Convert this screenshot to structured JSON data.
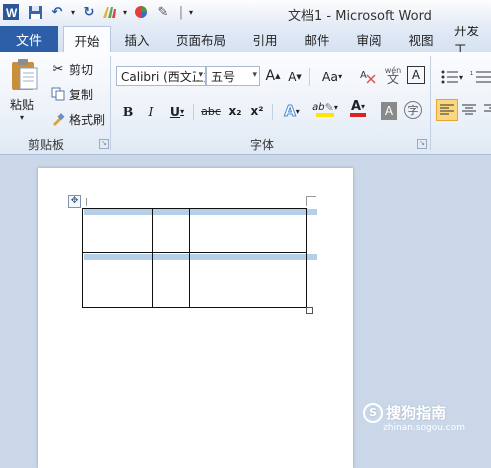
{
  "window": {
    "title": "文档1 - Microsoft Word"
  },
  "quick_access": {
    "app_icon": "word-icon",
    "save_icon": "save-icon",
    "undo_icon": "undo-icon",
    "redo_icon": "redo-icon",
    "format_icon": "format-painter-icon",
    "color_icon": "color-wheel-icon",
    "draw_icon": "drawing-icon",
    "customize_icon": "customize-qat-icon"
  },
  "tabs": {
    "file": "文件",
    "items": [
      "开始",
      "插入",
      "页面布局",
      "引用",
      "邮件",
      "审阅",
      "视图",
      "开发工"
    ],
    "active": "开始"
  },
  "ribbon": {
    "clipboard": {
      "label": "剪贴板",
      "paste": "粘贴",
      "cut": "剪切",
      "copy": "复制",
      "format_painter": "格式刷"
    },
    "font": {
      "label": "字体",
      "font_name": "Calibri (西文正文",
      "font_size": "五号",
      "grow": "A",
      "shrink": "A",
      "change_case": "Aa",
      "clear_format_label": "A",
      "phonetic_label": "wén",
      "border_char": "A",
      "bold": "B",
      "italic": "I",
      "underline": "U",
      "strikethrough": "abc",
      "subscript": "x₂",
      "superscript": "x²",
      "text_effect": "A",
      "highlight": "ab",
      "font_color": "A",
      "char_shading": "A",
      "enclose": "字"
    },
    "paragraph": {
      "bullets_icon": "bullets-icon",
      "align_left_icon": "align-left-icon",
      "center_icon": "center-icon"
    }
  },
  "colors": {
    "file_tab": "#2d5fa8",
    "highlight_row": "#b6cfe8",
    "font_color_bar": "#e02020",
    "highlight_bar": "#ffe600",
    "doc_background": "#c9d7e9"
  },
  "watermark": {
    "main": "搜狗指南",
    "sub": "zhinan.sogou.com"
  }
}
